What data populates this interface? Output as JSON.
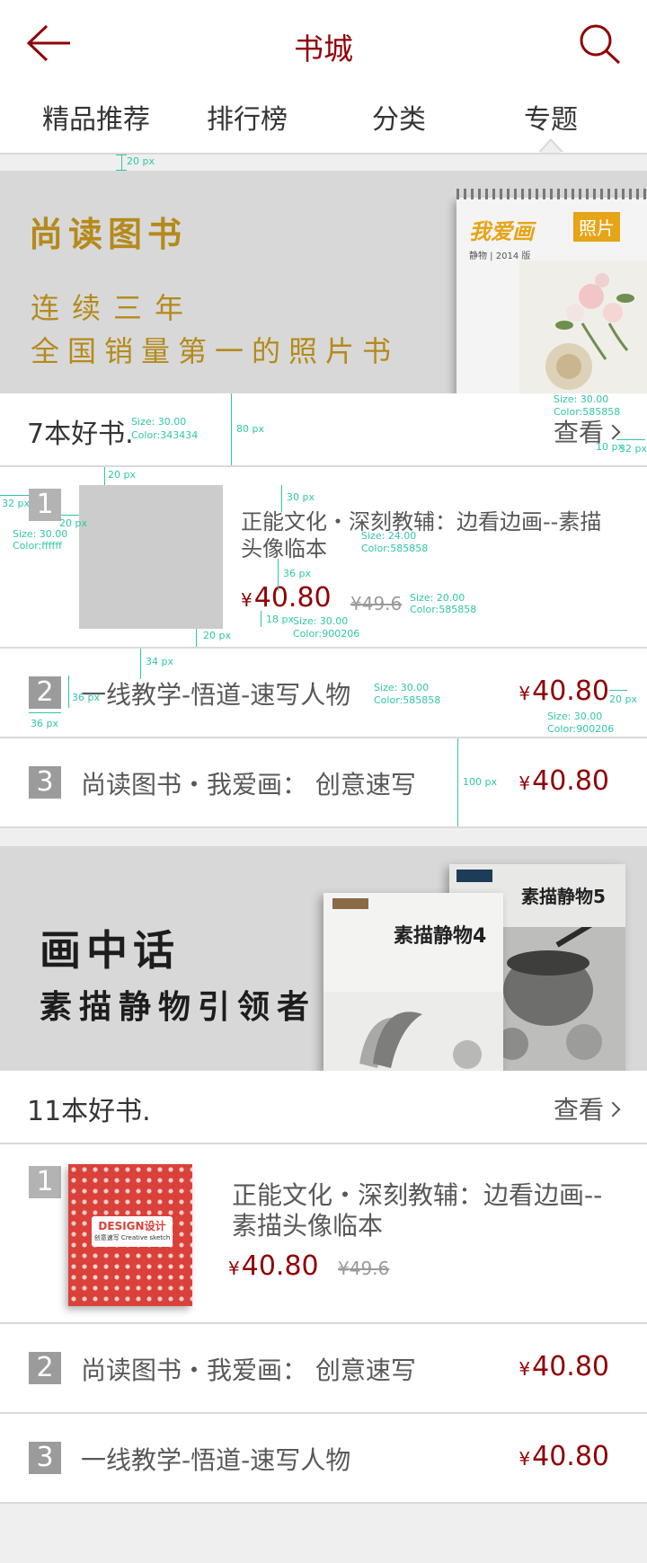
{
  "header": {
    "title": "书城",
    "back_icon": "arrow-left-icon",
    "search_icon": "search-icon",
    "accent_color": "#900206"
  },
  "tabs": [
    {
      "label": "精品推荐"
    },
    {
      "label": "排行榜"
    },
    {
      "label": "分类"
    },
    {
      "label": "专题",
      "active": true
    }
  ],
  "annotations": {
    "a1": "20 px",
    "a2": "80 px",
    "a3": "Size: 30.00",
    "a3b": "Color:343434",
    "a4": "Size: 30.00",
    "a4b": "Color:585858",
    "a5": "10 px",
    "a6": "32 px",
    "a7": "20 px",
    "a8": "32 px",
    "a9": "20 px",
    "a10": "Size: 30.00",
    "a10b": "Color:ffffff",
    "a11": "30 px",
    "a12": "Size: 24.00",
    "a12b": "Color:585858",
    "a13": "36 px",
    "a14": "18 px",
    "a15": "Size: 30.00",
    "a15b": "Color:900206",
    "a16": "Size: 20.00",
    "a16b": "Color:585858",
    "a17": "20 px",
    "a18": "34 px",
    "a19": "36 px",
    "a20": "36 px",
    "a21": "Size: 30.00",
    "a21b": "Color:585858",
    "a22": "20 px",
    "a23": "Size: 30.00",
    "a23b": "Color:900206",
    "a24": "100 px"
  },
  "section1": {
    "banner": {
      "brand": "尚读图书",
      "line1": "连续三年",
      "line2": "全国销量第一的照片书",
      "book_title": "我爱画",
      "book_badge": "照片",
      "book_sub": "静物 | 2014 版"
    },
    "title": "7本好书.",
    "more": "查看",
    "featured": {
      "rank": "1",
      "title": "正能文化・深刻教辅：边看边画--素描头像临本",
      "currency": "¥",
      "price": "40.80",
      "old_price": "¥49.6"
    },
    "items": [
      {
        "rank": "2",
        "title": "一线教学-悟道-速写人物",
        "currency": "¥",
        "price": "40.80"
      },
      {
        "rank": "3",
        "title": "尚读图书・我爱画：  创意速写",
        "currency": "¥",
        "price": "40.80"
      }
    ]
  },
  "section2": {
    "banner": {
      "line1": "画中话",
      "line2": "素描静物引领者",
      "book1": "素描静物4",
      "book2": "素描静物5"
    },
    "title": "11本好书.",
    "more": "查看",
    "featured": {
      "rank": "1",
      "title": "正能文化・深刻教辅：边看边画--素描头像临本",
      "cover_title": "DESIGN设计",
      "cover_sub": "创意速写 Creative sketch",
      "currency": "¥",
      "price": "40.80",
      "old_price": "¥49.6"
    },
    "items": [
      {
        "rank": "2",
        "title": "尚读图书・我爱画：  创意速写",
        "currency": "¥",
        "price": "40.80"
      },
      {
        "rank": "3",
        "title": "一线教学-悟道-速写人物",
        "currency": "¥",
        "price": "40.80"
      }
    ]
  }
}
